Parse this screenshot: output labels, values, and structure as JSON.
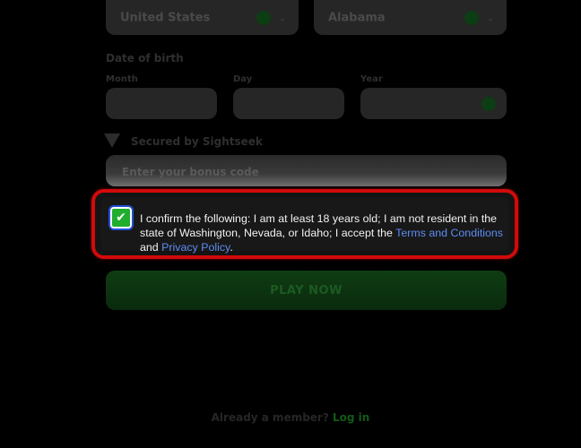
{
  "background_form": {
    "country_value": "United States",
    "state_value": "Alabama",
    "dob_label": "Date of birth",
    "month_label": "Month",
    "day_label": "Day",
    "year_label": "Year",
    "secured_label": "Secured by Sightseek",
    "promo_placeholder": "Enter your bonus code",
    "cta_label": "PLAY NOW",
    "footer_prompt": "Already a member?",
    "footer_login": "Log in"
  },
  "consent": {
    "checked": true,
    "text_before": "I confirm the following: I am at least 18 years old; I am not resident in the state of Washington, Nevada, or Idaho; I accept the ",
    "terms_link": "Terms and Conditions",
    "text_middle": " and ",
    "privacy_link": "Privacy Policy",
    "text_after": "."
  },
  "colors": {
    "highlight_border": "#d10a0a",
    "checkbox_fill": "#1fae2d",
    "link": "#5d8cf2"
  },
  "icons": {
    "checkbox": "check-icon",
    "select_arrow": "chevron-down-icon",
    "valid_indicator": "ok-dot-icon",
    "brand": "triangle-logo-icon"
  }
}
